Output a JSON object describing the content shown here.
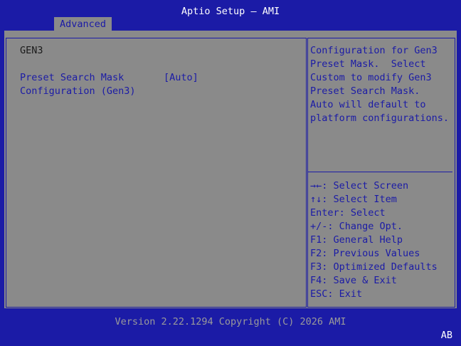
{
  "header": {
    "title": "Aptio Setup – AMI",
    "tab_label": "Advanced"
  },
  "main": {
    "section_title": "GEN3",
    "items": [
      {
        "label_line1": "Preset Search Mask",
        "label_line2": "Configuration (Gen3)",
        "value": "[Auto]"
      }
    ]
  },
  "help": {
    "description_lines": [
      "Configuration for Gen3",
      "Preset Mask.  Select",
      "Custom to modify Gen3",
      "Preset Search Mask.",
      "Auto will default to",
      "platform configurations."
    ],
    "keys": [
      "→←: Select Screen",
      "↑↓: Select Item",
      "Enter: Select",
      "+/-: Change Opt.",
      "F1: General Help",
      "F2: Previous Values",
      "F3: Optimized Defaults",
      "F4: Save & Exit",
      "ESC: Exit"
    ]
  },
  "footer": {
    "version": "Version 2.22.1294 Copyright (C) 2026 AMI",
    "corner": "AB"
  },
  "colors": {
    "background_blue": "#1b1ba6",
    "panel_gray": "#8a8a8a",
    "text_dark": "#1a1a1a",
    "footer_text": "#9a9a9a"
  }
}
